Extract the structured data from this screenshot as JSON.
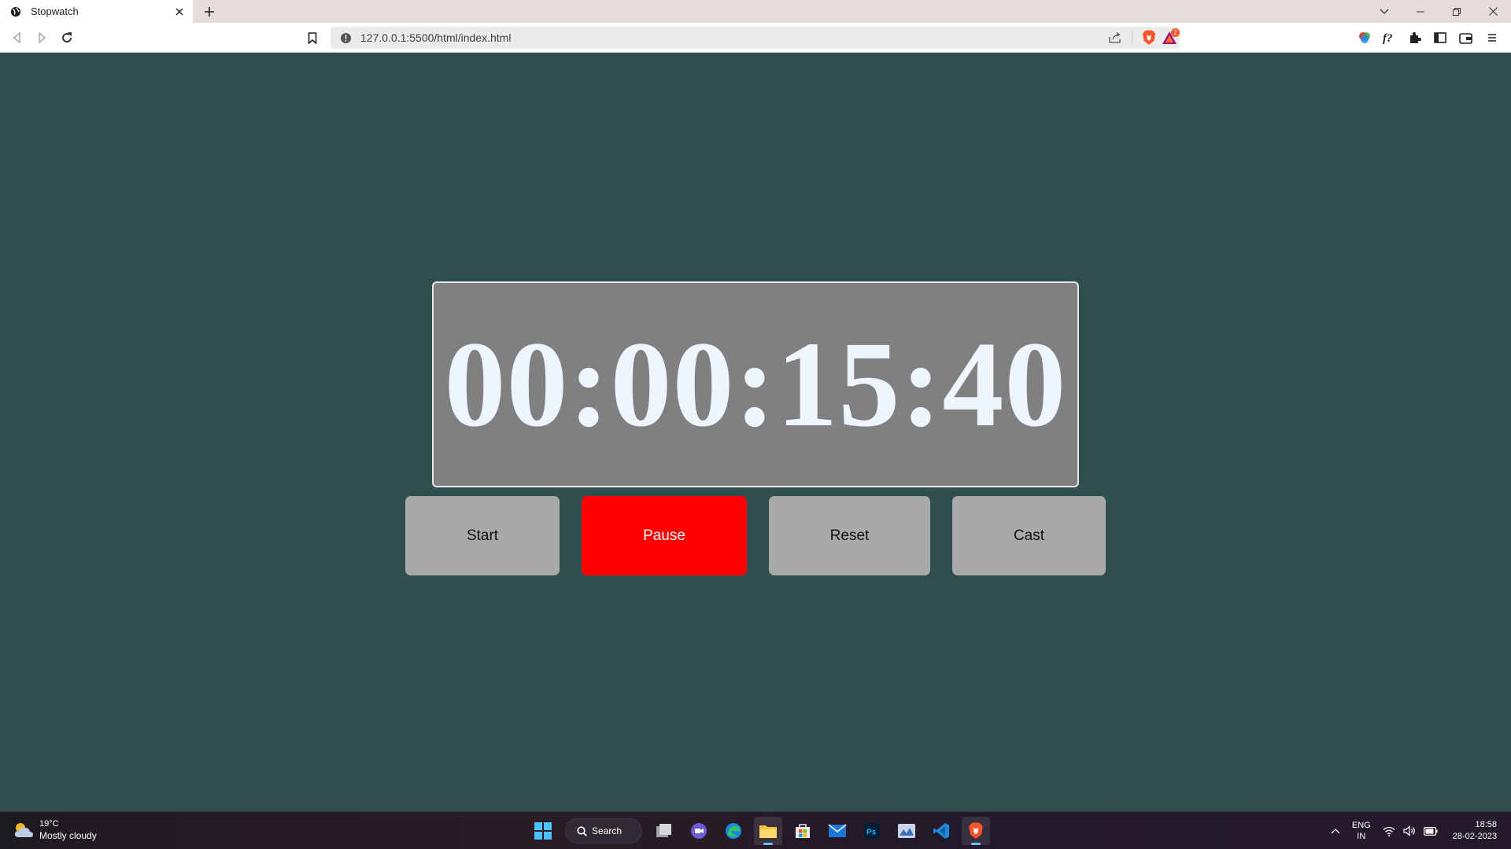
{
  "browser": {
    "tab_title": "Stopwatch",
    "url": "127.0.0.1:5500/html/index.html",
    "shields_badge": "2"
  },
  "stopwatch": {
    "time": "00:00:15:40",
    "buttons": {
      "start": "Start",
      "pause": "Pause",
      "reset": "Reset",
      "cast": "Cast"
    }
  },
  "taskbar": {
    "weather_temp": "19°C",
    "weather_desc": "Mostly cloudy",
    "search_label": "Search",
    "lang_top": "ENG",
    "lang_bottom": "IN",
    "time": "18:58",
    "date": "28-02-2023",
    "apps": [
      "windows-start",
      "search",
      "task-view",
      "teams-chat",
      "edge",
      "file-explorer",
      "microsoft-store",
      "mail",
      "photoshop",
      "photos",
      "vscode",
      "brave"
    ]
  },
  "colors": {
    "page_bg": "#2f4f4f",
    "display_bg": "#808080",
    "button_bg": "#a9a9a9",
    "pause_bg": "#ff0000",
    "time_color": "#eef5ff"
  }
}
